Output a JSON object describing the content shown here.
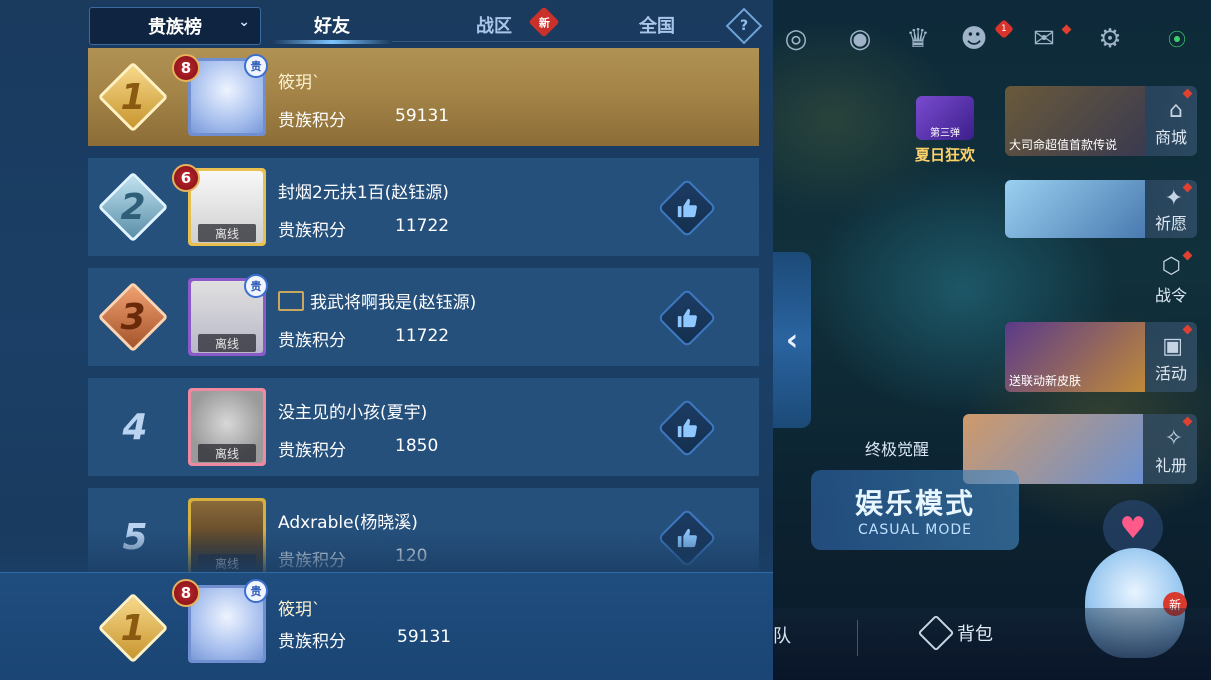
{
  "header": {
    "rank_type": "贵族榜",
    "tabs": [
      {
        "label": "好友",
        "active": true
      },
      {
        "label": "战区",
        "active": false,
        "badge": "新"
      },
      {
        "label": "全国",
        "active": false
      }
    ],
    "help_label": "?"
  },
  "leaderboard": [
    {
      "rank": "1",
      "level": "8",
      "name": "筱玥`",
      "score_label": "贵族积分",
      "score": "59131",
      "offline": "",
      "highlight": true,
      "noble_badge": "贵"
    },
    {
      "rank": "2",
      "level": "6",
      "name": "封烟2元扶1百(赵钰源)",
      "score_label": "贵族积分",
      "score": "11722",
      "offline": "离线",
      "highlight": false
    },
    {
      "rank": "3",
      "level": "",
      "name": "我武将啊我是(赵钰源)",
      "score_label": "贵族积分",
      "score": "11722",
      "offline": "离线",
      "highlight": false,
      "noble_badge": "贵"
    },
    {
      "rank": "4",
      "level": "",
      "name": "没主见的小孩(夏宇)",
      "score_label": "贵族积分",
      "score": "1850",
      "offline": "离线",
      "highlight": false
    },
    {
      "rank": "5",
      "level": "",
      "name": "Adxrable(杨晓溪)",
      "score_label": "贵族积分",
      "score": "120",
      "offline": "离线",
      "highlight": false
    }
  ],
  "self": {
    "rank": "1",
    "level": "8",
    "name": "筱玥`",
    "score_label": "贵族积分",
    "score": "59131",
    "noble_badge": "贵"
  },
  "right_panel": {
    "top_badge_count": "1",
    "summer_event": {
      "label": "夏日狂欢",
      "sub": "第三弹"
    },
    "cards": [
      {
        "label": "商城",
        "caption": "大司命超值首款传说"
      },
      {
        "label": "祈愿",
        "caption": ""
      },
      {
        "label": "战令",
        "caption": ""
      },
      {
        "label": "活动",
        "caption": "送联动新皮肤"
      },
      {
        "label": "礼册",
        "caption": ""
      }
    ],
    "awaken_label": "终极觉醒",
    "casual_mode_cn": "娱乐模式",
    "casual_mode_en": "CASUAL MODE",
    "bottom_team": "队",
    "bottom_bag": "背包",
    "mascot_badge": "新",
    "colors": {
      "accent": "#7cc4ff",
      "highlight_row": "#a48447",
      "badge_red": "#d8342c"
    }
  }
}
